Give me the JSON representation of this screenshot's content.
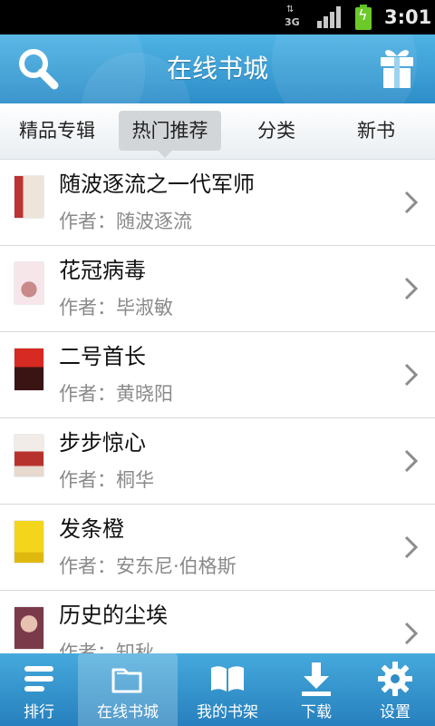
{
  "status_bar": {
    "network": "3G",
    "time": "3:01"
  },
  "header": {
    "title": "在线书城",
    "left_icon": "search-icon",
    "right_icon": "gift-icon"
  },
  "tabs": [
    {
      "label": "精品专辑"
    },
    {
      "label": "热门推荐"
    },
    {
      "label": "分类"
    },
    {
      "label": "新书"
    }
  ],
  "active_tab": "热门推荐",
  "books": [
    {
      "title": "随波逐流之一代军师",
      "author": "作者：随波逐流",
      "cover_color": "#e9e2d8"
    },
    {
      "title": "花冠病毒",
      "author": "作者：毕淑敏",
      "cover_color": "#f3dfe3"
    },
    {
      "title": "二号首长",
      "author": "作者：黄晓阳",
      "cover_color": "#c8231f"
    },
    {
      "title": "步步惊心",
      "author": "作者：桐华",
      "cover_color": "#efe9e4"
    },
    {
      "title": "发条橙",
      "author": "作者：安东尼·伯格斯",
      "cover_color": "#f1d21a"
    },
    {
      "title": "历史的尘埃",
      "author": "作者：知秋",
      "cover_color": "#8a4a5a"
    }
  ],
  "bottom_nav": [
    {
      "label": "排行",
      "icon": "list-icon"
    },
    {
      "label": "在线书城",
      "icon": "folder-icon"
    },
    {
      "label": "我的书架",
      "icon": "open-book-icon"
    },
    {
      "label": "下载",
      "icon": "download-icon"
    },
    {
      "label": "设置",
      "icon": "gear-icon"
    }
  ],
  "active_nav": "在线书城",
  "colors": {
    "header_top": "#4fb3e4",
    "header_bottom": "#2e8ec9",
    "nav_top": "#45a9dc",
    "nav_bottom": "#2780bd"
  }
}
